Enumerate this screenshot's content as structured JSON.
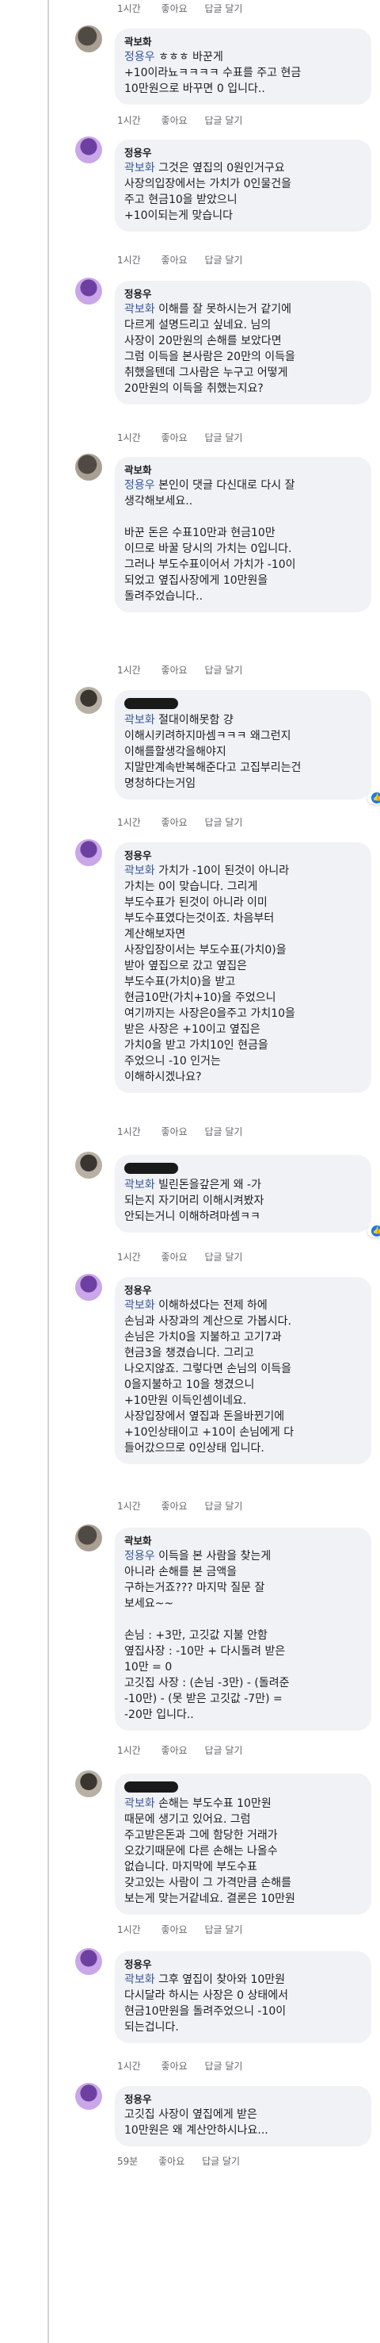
{
  "actions": {
    "like": "좋아요",
    "reply": "답글 달기"
  },
  "comments": [
    {
      "author": "",
      "time": "1시간",
      "mention": "",
      "text": ""
    },
    {
      "author": "곽보화",
      "time": "1시간",
      "mention": "정용우",
      "text": " ㅎㅎㅎ 바꾼게\n+10이라뇨ㅋㅋㅋㅋ 수표를 주고 현금\n10만원으로 바꾸면 0 입니다.."
    },
    {
      "author": "정용우",
      "time": "1시간",
      "mention": "곽보화",
      "text": " 그것은 옆집의 0원인거구요\n사장의입장에서는 가치가 0인물건을\n주고 현금10을 받았으니\n+10이되는게 맞습니다"
    },
    {
      "author": "정용우",
      "time": "1시간",
      "mention": "곽보화",
      "text": " 이해를 잘 못하시는거 같기에\n다르게 설명드리고 싶네요. 님의\n사장이 20만원의 손해를 보았다면\n그럼 이득을 본사람은 20만의 이득을\n취했을텐데 그사람은 누구고 어떻게\n20만원의 이득을 취했는지요?"
    },
    {
      "author": "곽보화",
      "time": "1시간",
      "mention": "정용우",
      "text": " 본인이 댓글 다신대로 다시 잘\n생각해보세요..\n\n바꾼 돈은 수표10만과 현금10만\n이므로 바꿀 당시의 가치는 0입니다.\n그러나 부도수표이어서 가치가 -10이\n되었고 옆집사장에게 10만원을\n돌려주었습니다.."
    },
    {
      "author": "",
      "time": "1시간",
      "mention": "곽보화",
      "text": " 절대이해못함 걍\n이해시키려하지마셈ㅋㅋㅋ 왜그런지\n이해를할생각을해야지\n지말만계속반복해준다고 고집부리는건\n명청하다는거임",
      "reactions": "1"
    },
    {
      "author": "정용우",
      "time": "1시간",
      "mention": "곽보화",
      "text": " 가치가 -10이 된것이 아니라\n가치는 0이 맞습니다. 그리게\n부도수표가 된것이 아니라 이미\n부도수표였다는것이죠. 차음부터\n계산해보자면\n사장입장이서는 부도수표(가치0)을\n받아 옆집으로 갔고 옆집은\n부도수표(가치0)을 받고\n현금10만(가치+10)을 주었으니\n여기까지는 사장은0을주고 가치10을\n받은 사장은 +10이고 옆집은\n가치0을 받고 가치10인 현금을\n주었으니 -10 인거는\n이해하시겠나요?"
    },
    {
      "author": "",
      "time": "1시간",
      "mention": "곽보화",
      "text": " 빌린돈을갚은게 왜 -가\n되는지 자기머리 이해시켜봤자\n안되는거니 이해하려마셈ㅋㅋ",
      "reactions": "1"
    },
    {
      "author": "정용우",
      "time": "1시간",
      "mention": "곽보화",
      "text": " 이해하셨다는 전제 하에\n손님과 사장과의 계산으로 가봅시다.\n손님은 가치0을 지불하고 고기7과\n현금3을 챙겼습니다. 그리고\n나오지않죠. 그렇다면 손님의 이득을\n0을지불하고 10을 챙겼으니\n+10만원 이득인셈이네요.\n사장입장에서 옆집과 돈을바뀐기에\n+10인상태이고 +10이 손님에게 다\n들어갔으므로 0인상태 입니다."
    },
    {
      "author": "곽보화",
      "time": "1시간",
      "mention": "정용우",
      "text": " 이득을 본 사람을 찾는게\n아니라 손해를 본 금액을\n구하는거죠??? 마지막 질문 잘\n보세요~~\n\n손님 : +3만, 고깃값 지불 안함\n옆집사장 : -10만 + 다시돌려 받은\n10만 = 0\n고깃집 사장 : (손님 -3만) - (돌려준\n-10만) - (못 받은 고깃값 -7만) =\n-20만 입니다.."
    },
    {
      "author": "",
      "time": "1시간",
      "mention": "곽보화",
      "text": " 손해는 부도수표 10만원\n때문에 생기고 있어요. 그럼\n주고받은돈과 그에 함당한 거래가\n오갔기때문에 다른 손해는 나올수\n없습니다. 마지막에 부도수표\n갖고있는 사람이 그 가격만큼 손해를\n보는게 맞는거같네요. 결론은 10만원"
    },
    {
      "author": "정용우",
      "time": "1시간",
      "mention": "곽보화",
      "text": " 그후 옆집이 찾아와 10만원\n다시달라 하시는 사장은 0 상태에서\n현금10만원을 돌려주었으니 -10이\n되는겁니다."
    },
    {
      "author": "정용우",
      "time": "59분",
      "mention": "",
      "text": "고깃집 사장이 옆집에게 받은\n10만원은 왜 계산안하시나요..."
    }
  ]
}
